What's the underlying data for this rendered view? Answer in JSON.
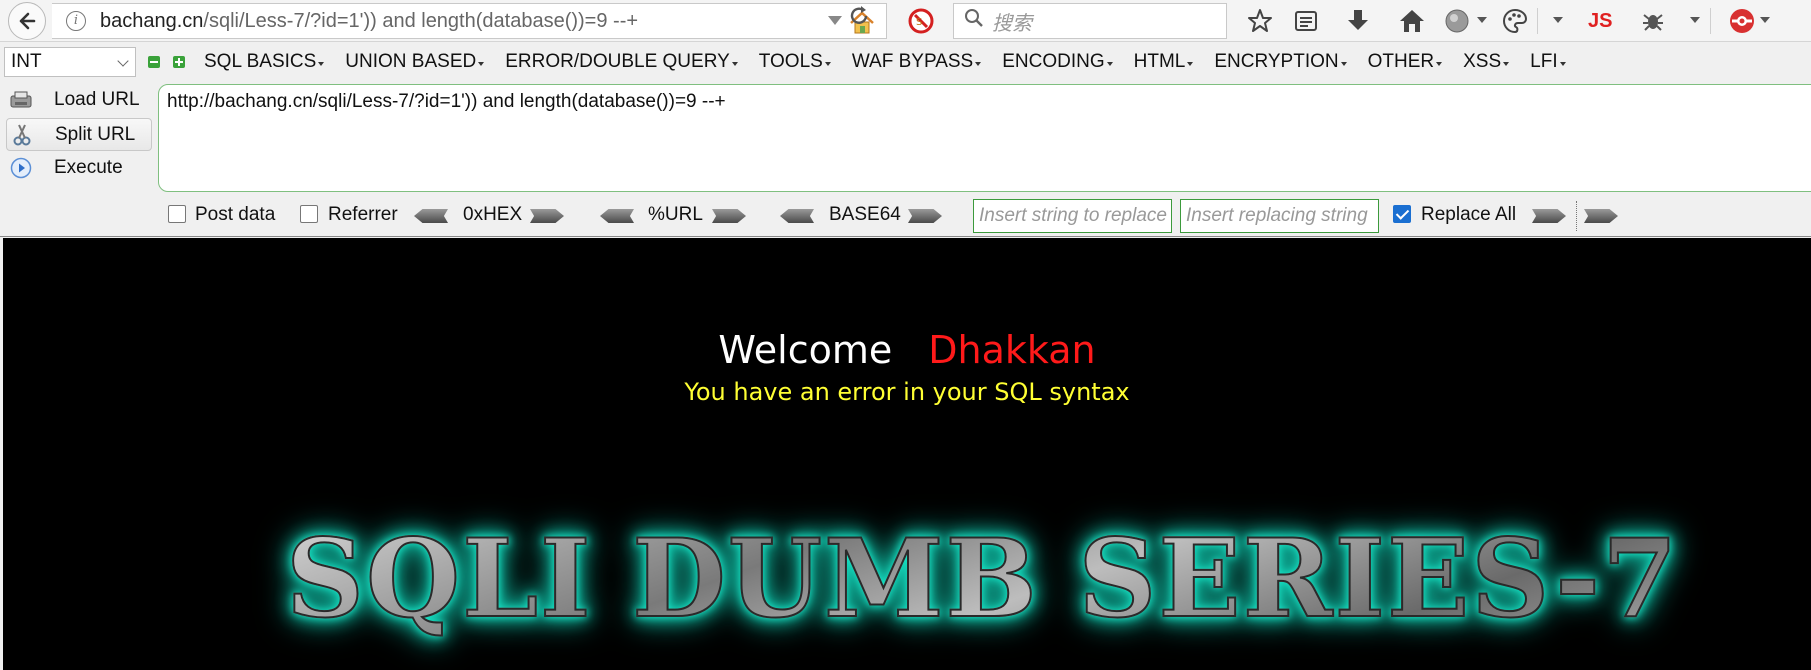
{
  "navbar": {
    "url_host": "bachang.cn",
    "url_path": "/sqli/Less-7/?id=1')) and length(database())=9 --+",
    "search_placeholder": "搜索",
    "js_badge": "JS"
  },
  "hackbar": {
    "type_select": "INT",
    "menu": [
      "SQL BASICS",
      "UNION BASED",
      "ERROR/DOUBLE QUERY",
      "TOOLS",
      "WAF BYPASS",
      "ENCODING",
      "HTML",
      "ENCRYPTION",
      "OTHER",
      "XSS",
      "LFI"
    ],
    "buttons": {
      "load": "Load URL",
      "split": "Split URL",
      "execute": "Execute"
    },
    "url_value": "http://bachang.cn/sqli/Less-7/?id=1')) and length(database())=9 --+",
    "post_data_label": "Post data",
    "referrer_label": "Referrer",
    "hex_label": "0xHEX",
    "urlenc_label": "%URL",
    "base64_label": "BASE64",
    "replace_from_placeholder": "Insert string to replace",
    "replace_to_placeholder": "Insert replacing string",
    "replace_all_label": "Replace All",
    "post_data_checked": false,
    "referrer_checked": false,
    "replace_all_checked": true
  },
  "page": {
    "welcome": "Welcome",
    "name": "Dhakkan",
    "error": "You have an error in your SQL syntax",
    "banner": "SQLI DUMB SERIES-7"
  },
  "colors": {
    "welcome_name": "#ff1a1a",
    "error_text": "#ffff33",
    "banner_glow": "#19e6c8",
    "hackbar_green": "#3aa23a"
  }
}
